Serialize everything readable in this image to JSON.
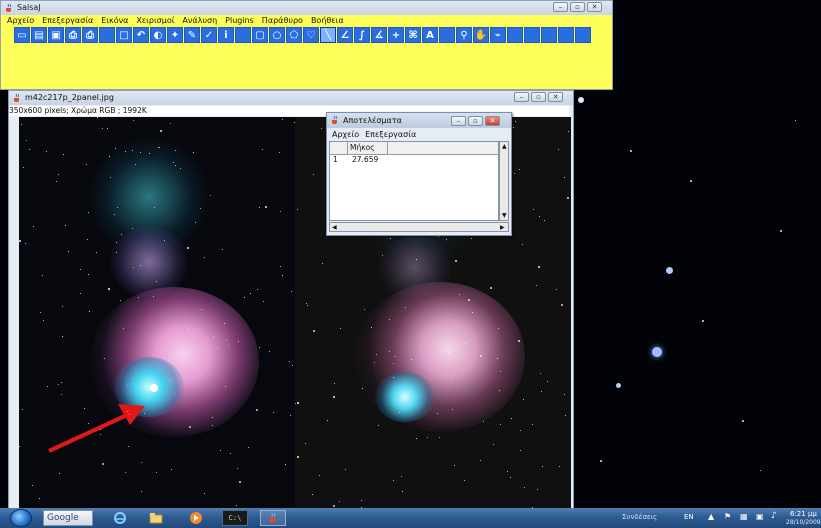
{
  "main_window": {
    "title": "SalsaJ",
    "menu": [
      "Αρχείο",
      "Επεξεργασία",
      "Εικόνα",
      "Χειρισμοί",
      "Ανάλυση",
      "Plugins",
      "Παράθυρο",
      "Βοήθεια"
    ],
    "tools": [
      {
        "name": "new-file-icon",
        "glyph": "▭"
      },
      {
        "name": "open-folder-icon",
        "glyph": "▤"
      },
      {
        "name": "save-icon",
        "glyph": "▣"
      },
      {
        "name": "print-icon",
        "glyph": "⎙"
      },
      {
        "name": "print-preview-icon",
        "glyph": "⎙"
      },
      {
        "name": "blank-tool-1",
        "glyph": ""
      },
      {
        "name": "rectangle-select-icon",
        "glyph": "□"
      },
      {
        "name": "undo-icon",
        "glyph": "↶"
      },
      {
        "name": "contrast-icon",
        "glyph": "◐"
      },
      {
        "name": "magic-wand-icon",
        "glyph": "✦"
      },
      {
        "name": "brush-icon",
        "glyph": "✎"
      },
      {
        "name": "color-picker-icon",
        "glyph": "✓"
      },
      {
        "name": "info-icon",
        "glyph": "i"
      },
      {
        "name": "blank-tool-2",
        "glyph": ""
      },
      {
        "name": "rect-tool-icon",
        "glyph": "▢"
      },
      {
        "name": "oval-tool-icon",
        "glyph": "○"
      },
      {
        "name": "polygon-tool-icon",
        "glyph": "⬠"
      },
      {
        "name": "freehand-tool-icon",
        "glyph": "♡"
      },
      {
        "name": "line-tool-icon",
        "glyph": "╲"
      },
      {
        "name": "segmented-line-icon",
        "glyph": "∠"
      },
      {
        "name": "freehand-line-icon",
        "glyph": "∫"
      },
      {
        "name": "angle-tool-icon",
        "glyph": "∡"
      },
      {
        "name": "crosshair-icon",
        "glyph": "+"
      },
      {
        "name": "wand-select-icon",
        "glyph": "⌘"
      },
      {
        "name": "text-tool-icon",
        "glyph": "A"
      },
      {
        "name": "blank-tool-3",
        "glyph": ""
      },
      {
        "name": "magnifier-icon",
        "glyph": "⚲"
      },
      {
        "name": "hand-tool-icon",
        "glyph": "✋"
      },
      {
        "name": "dropper-icon",
        "glyph": "⌁"
      },
      {
        "name": "blank-tool-4",
        "glyph": ""
      },
      {
        "name": "blank-tool-5",
        "glyph": ""
      },
      {
        "name": "blank-tool-6",
        "glyph": ""
      },
      {
        "name": "blank-tool-7",
        "glyph": ""
      },
      {
        "name": "blank-tool-8",
        "glyph": ""
      }
    ]
  },
  "image_window": {
    "title": "m42c217p_2panel.jpg",
    "info": "350x600 pixels; Χρώμα RGB ; 1992K"
  },
  "results_window": {
    "title": "Αποτελέσματα",
    "menu": [
      "Αρχείο",
      "Επεξεργασία"
    ],
    "column_header": "Μήκος",
    "rows": [
      {
        "index": "1",
        "value": "27.659"
      }
    ]
  },
  "taskbar": {
    "search_label": "Google",
    "toolbar_label": "Συνδέσεις",
    "language": "EN",
    "time": "6:21 μμ",
    "date": "28/10/2009"
  },
  "colors": {
    "salsaj_yellow": "#ffff5a",
    "tool_blue": "#2a6de0",
    "arrow_red": "#e01818"
  }
}
